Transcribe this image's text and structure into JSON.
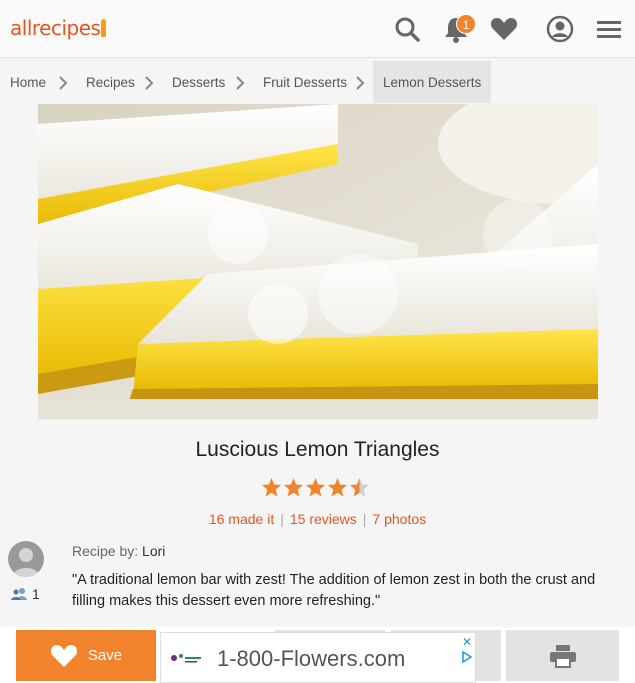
{
  "header": {
    "logo_text": "allrecipes",
    "icons": [
      "search-icon",
      "bell-icon",
      "heart-icon",
      "profile-icon",
      "menu-icon"
    ],
    "notification_count": "1"
  },
  "breadcrumb": {
    "items": [
      "Home",
      "Recipes",
      "Desserts",
      "Fruit Desserts",
      "Lemon Desserts"
    ]
  },
  "recipe": {
    "title": "Luscious Lemon Triangles",
    "rating": 4.5,
    "made_it": "16 made it",
    "reviews": "15 reviews",
    "photos": "7 photos",
    "byline_label": "Recipe by:",
    "author": "Lori",
    "followers": "1",
    "description": "\"A traditional lemon bar with zest! The addition of lemon zest in both the crust and filling makes this dessert even more refreshing.\""
  },
  "actions": {
    "save_label": "Save",
    "ad_text": "1-800-Flowers.com",
    "ad_close": "✕"
  },
  "colors": {
    "brand": "#e8541e",
    "accent": "#f0832b",
    "star": "#f0832b"
  }
}
